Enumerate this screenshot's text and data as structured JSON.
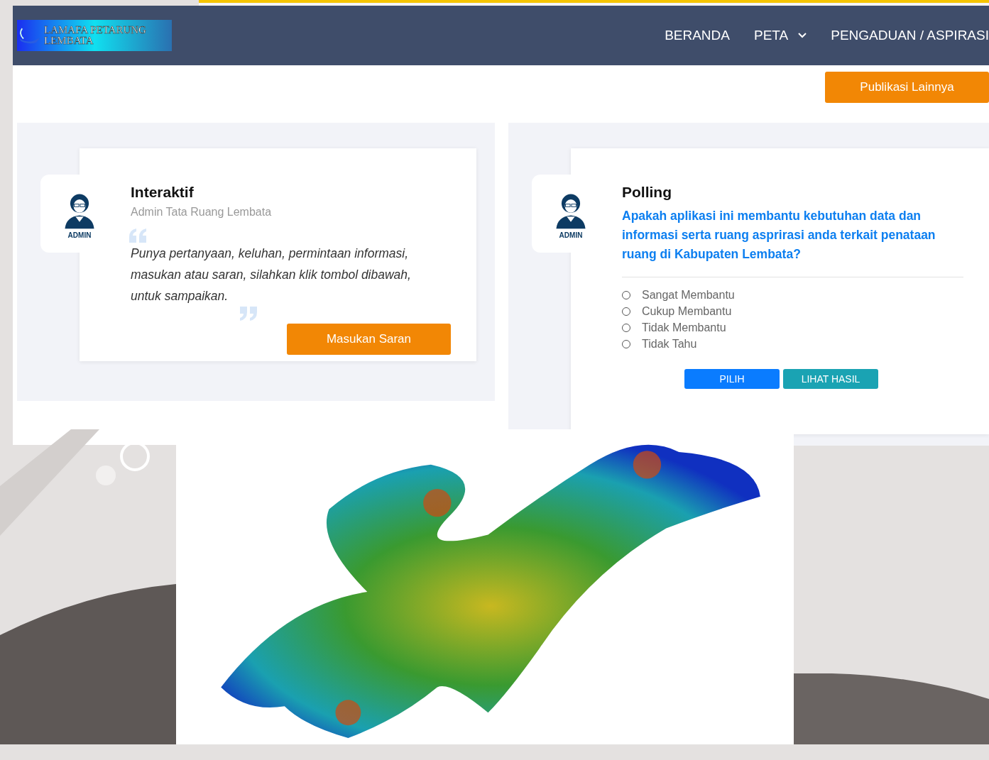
{
  "header": {
    "logo_text": "LAMAFA PETARUNG LEMBATA",
    "nav": [
      {
        "label": "BERANDA",
        "dropdown": false
      },
      {
        "label": "PETA",
        "dropdown": true
      },
      {
        "label": "PENGADUAN / ASPIRASI",
        "dropdown": false
      }
    ]
  },
  "publikasi_button": "Publikasi Lainnya",
  "interaktif": {
    "avatar_label": "ADMIN",
    "title": "Interaktif",
    "subtitle": "Admin Tata Ruang Lembata",
    "quote": "Punya pertanyaan, keluhan, permintaan informasi, masukan atau saran, silahkan klik tombol dibawah, untuk sampaikan.",
    "button": "Masukan Saran"
  },
  "polling": {
    "avatar_label": "ADMIN",
    "title": "Polling",
    "question": "Apakah aplikasi ini membantu kebutuhan data dan informasi serta ruang asprirasi anda terkait penataan ruang di Kabupaten Lembata?",
    "options": [
      {
        "label": "Sangat Membantu",
        "selected": false
      },
      {
        "label": "Cukup Membantu",
        "selected": false
      },
      {
        "label": "Tidak Membantu",
        "selected": false
      },
      {
        "label": "Tidak Tahu",
        "selected": false
      }
    ],
    "buttons": [
      {
        "label": "PILIH",
        "kind": "primary"
      },
      {
        "label": "LIHAT HASIL",
        "kind": "info"
      }
    ]
  }
}
